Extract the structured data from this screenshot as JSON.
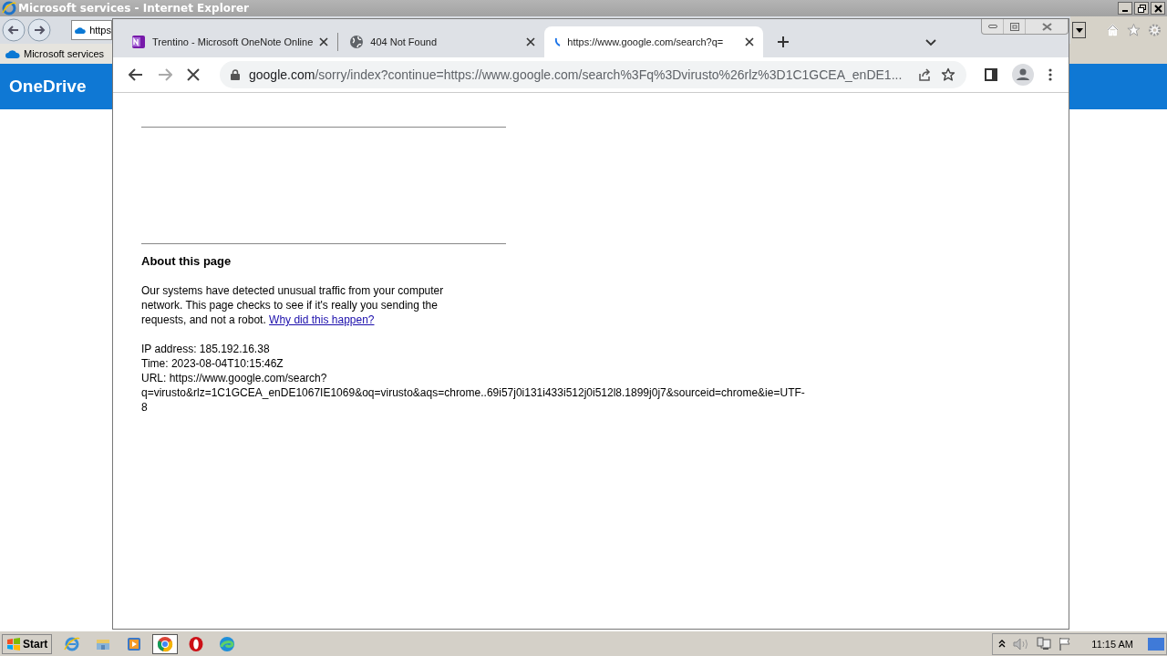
{
  "ie": {
    "title": "Microsoft services - Internet Explorer",
    "address": "https",
    "tab": "Microsoft services",
    "brand": "OneDrive"
  },
  "chrome": {
    "tabs": [
      {
        "title": "Trentino - Microsoft OneNote Online",
        "selected": false,
        "kind": "onenote"
      },
      {
        "title": "404 Not Found",
        "selected": false,
        "kind": "globe"
      },
      {
        "title": "https://www.google.com/search?q=",
        "selected": true,
        "kind": "loading"
      }
    ],
    "address": {
      "host": "google.com",
      "path": "/sorry/index?continue=https://www.google.com/search%3Fq%3Dvirusto%26rlz%3D1C1GCEA_enDE1..."
    }
  },
  "page": {
    "heading": "About this page",
    "paragraph": "Our systems have detected unusual traffic from your computer network. This page checks to see if it's really you sending the requests, and not a robot.",
    "link": "Why did this happen?",
    "details": [
      "IP address: 185.192.16.38",
      "Time: 2023-08-04T10:15:46Z",
      "URL: https://www.google.com/search?",
      "q=virusto&rlz=1C1GCEA_enDE1067IE1069&oq=virusto&aqs=chrome..69i57j0i131i433i512j0i512l8.1899j0j7&sourceid=chrome&ie=UTF-",
      "8"
    ]
  },
  "taskbar": {
    "start": "Start",
    "apps": [
      {
        "kind": "ie",
        "selected": false
      },
      {
        "kind": "folder",
        "selected": false
      },
      {
        "kind": "media",
        "selected": false
      },
      {
        "kind": "chrome",
        "selected": true
      },
      {
        "kind": "opera",
        "selected": false
      },
      {
        "kind": "edge",
        "selected": false
      }
    ],
    "clock": "11:15 AM"
  }
}
